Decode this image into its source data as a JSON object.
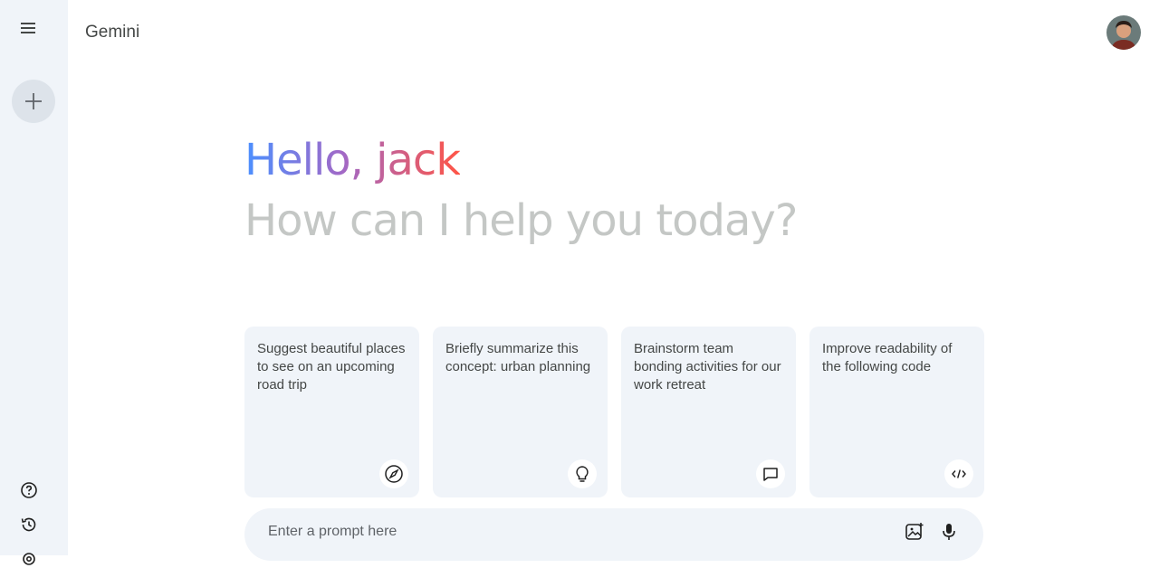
{
  "app": {
    "title": "Gemini"
  },
  "greeting": {
    "hello": "Hello, jack",
    "subtitle": "How can I help you today?"
  },
  "cards": [
    {
      "text": "Suggest beautiful places to see on an upcoming road trip",
      "icon": "compass-icon"
    },
    {
      "text": "Briefly summarize this concept: urban planning",
      "icon": "bulb-icon"
    },
    {
      "text": "Brainstorm team bonding activities for our work retreat",
      "icon": "message-icon"
    },
    {
      "text": "Improve readability of the following code",
      "icon": "code-icon"
    }
  ],
  "prompt": {
    "placeholder": "Enter a prompt here"
  },
  "colors": {
    "sidebar_bg": "#f0f4f9",
    "card_bg": "#f0f4f9",
    "gradient_start": "#4b90ff",
    "gradient_end": "#ff5546",
    "muted": "#c4c7c5"
  }
}
